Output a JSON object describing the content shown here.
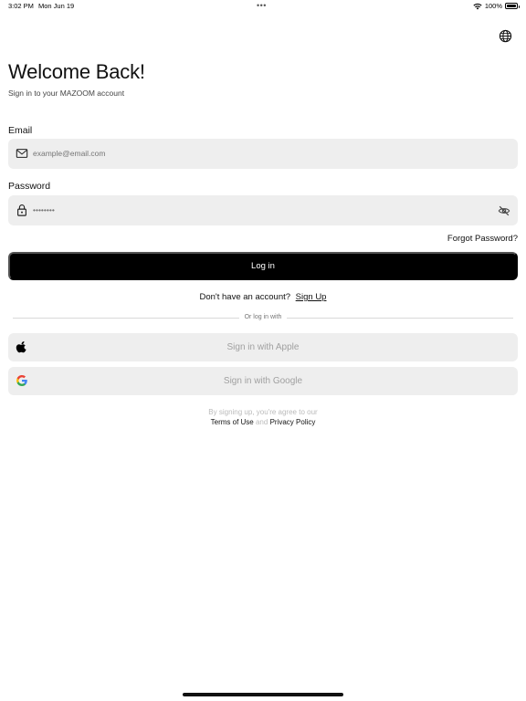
{
  "status_bar": {
    "time": "3:02 PM",
    "date": "Mon Jun 19",
    "dots": "•••",
    "battery_text": "100%",
    "battery_level": 1.0,
    "icons": [
      "wifi-icon",
      "battery-icon"
    ]
  },
  "header": {
    "language_icon": "globe-icon"
  },
  "welcome": {
    "title": "Welcome Back!",
    "subtitle": "Sign in to your MAZOOM account"
  },
  "form": {
    "email": {
      "label": "Email",
      "placeholder": "example@email.com",
      "value": "",
      "icon": "mail-icon"
    },
    "password": {
      "label": "Password",
      "placeholder": "••••••••",
      "value": "",
      "icon": "lock-icon",
      "toggle_icon": "eye-off-icon"
    },
    "forgot_password": "Forgot Password?",
    "login_button": "Log in"
  },
  "signup": {
    "prompt": "Don't have an account?",
    "link": "Sign Up"
  },
  "divider_text": "Or log in with",
  "social": {
    "apple": {
      "label": "Sign in with Apple",
      "icon": "apple-icon"
    },
    "google": {
      "label": "Sign in with Google",
      "icon": "google-icon"
    }
  },
  "legal": {
    "prefix": "By signing up, you're agree to our",
    "terms": "Terms of Use",
    "and": "and",
    "privacy": "Privacy Policy"
  },
  "colors": {
    "background": "#ffffff",
    "input_background": "#eeeeee",
    "primary_button": "#000000",
    "muted_text": "#a0a0a0"
  }
}
